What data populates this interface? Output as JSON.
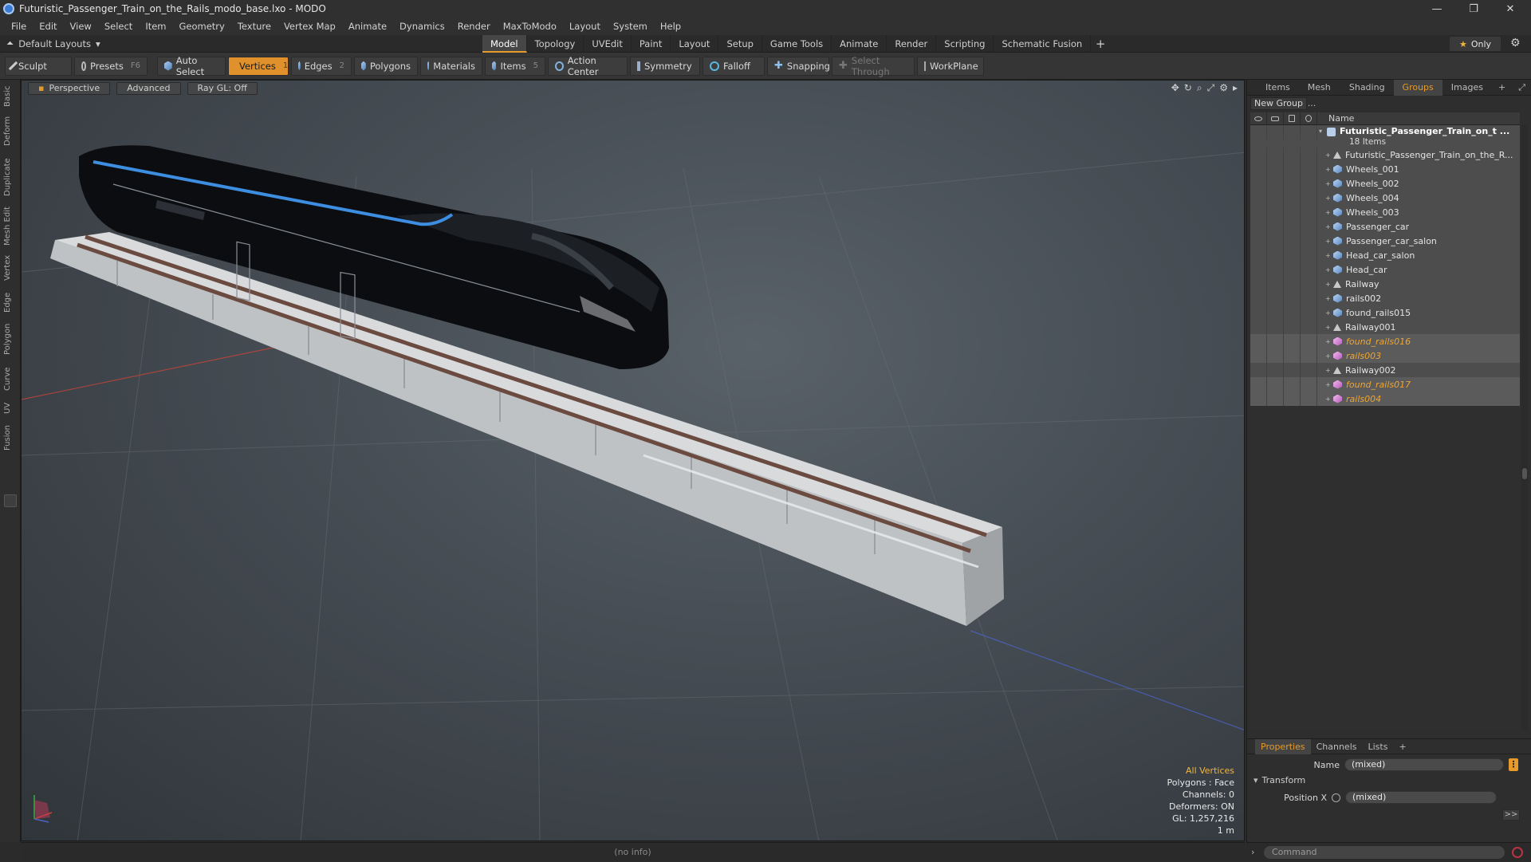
{
  "window": {
    "title": "Futuristic_Passenger_Train_on_the_Rails_modo_base.lxo - MODO",
    "controls": [
      "—",
      "❐",
      "✕"
    ]
  },
  "menu": [
    "File",
    "Edit",
    "View",
    "Select",
    "Item",
    "Geometry",
    "Texture",
    "Vertex Map",
    "Animate",
    "Dynamics",
    "Render",
    "MaxToModo",
    "Layout",
    "System",
    "Help"
  ],
  "layoutbar": {
    "layout_name": "Default Layouts",
    "tabs": [
      "Model",
      "Topology",
      "UVEdit",
      "Paint",
      "Layout",
      "Setup",
      "Game Tools",
      "Animate",
      "Render",
      "Scripting",
      "Schematic Fusion"
    ],
    "active_tab": "Model",
    "only_label": "Only"
  },
  "toolbar": {
    "sculpt": "Sculpt",
    "presets": "Presets",
    "presets_key": "F6",
    "auto_select": "Auto Select",
    "vertices": "Vertices",
    "vertices_count": "1",
    "edges": "Edges",
    "edges_count": "2",
    "polygons": "Polygons",
    "materials": "Materials",
    "items": "Items",
    "items_count": "5",
    "action_center": "Action Center",
    "symmetry": "Symmetry",
    "falloff": "Falloff",
    "snapping": "Snapping",
    "select_through": "Select Through",
    "workplane": "WorkPlane"
  },
  "left_tabs": [
    "Basic",
    "Deform",
    "Duplicate",
    "Mesh Edit",
    "Vertex",
    "Edge",
    "Polygon",
    "Curve",
    "UV",
    "Fusion"
  ],
  "viewport": {
    "view_mode": "Perspective",
    "advanced": "Advanced",
    "raygl": "Ray GL: Off",
    "info": {
      "selection": "All Vertices",
      "polygons": "Polygons : Face",
      "channels": "Channels: 0",
      "deformers": "Deformers: ON",
      "gl": "GL: 1,257,216",
      "scale": "1 m"
    }
  },
  "right_panel": {
    "tabs": [
      "Items",
      "Mesh ...",
      "Shading",
      "Groups",
      "Images"
    ],
    "active_tab": "Groups",
    "new_group": "New Group",
    "column_name": "Name",
    "group": {
      "name": "Futuristic_Passenger_Train_on_t ...",
      "count": "18 Items"
    },
    "items": [
      {
        "name": "Futuristic_Passenger_Train_on_the_R...",
        "type": "locator",
        "selected": false
      },
      {
        "name": "Wheels_001",
        "type": "mesh",
        "selected": false
      },
      {
        "name": "Wheels_002",
        "type": "mesh",
        "selected": false
      },
      {
        "name": "Wheels_004",
        "type": "mesh",
        "selected": false
      },
      {
        "name": "Wheels_003",
        "type": "mesh",
        "selected": false
      },
      {
        "name": "Passenger_car",
        "type": "mesh",
        "selected": false
      },
      {
        "name": "Passenger_car_salon",
        "type": "mesh",
        "selected": false
      },
      {
        "name": "Head_car_salon",
        "type": "mesh",
        "selected": false
      },
      {
        "name": "Head_car",
        "type": "mesh",
        "selected": false
      },
      {
        "name": "Railway",
        "type": "locator",
        "selected": false
      },
      {
        "name": "rails002",
        "type": "mesh",
        "selected": false
      },
      {
        "name": "found_rails015",
        "type": "mesh",
        "selected": false
      },
      {
        "name": "Railway001",
        "type": "locator",
        "selected": false
      },
      {
        "name": "found_rails016",
        "type": "instance",
        "selected": true
      },
      {
        "name": "rails003",
        "type": "instance",
        "selected": true
      },
      {
        "name": "Railway002",
        "type": "locator",
        "selected": false
      },
      {
        "name": "found_rails017",
        "type": "instance",
        "selected": true
      },
      {
        "name": "rails004",
        "type": "instance",
        "selected": true
      }
    ]
  },
  "properties": {
    "tabs": [
      "Properties",
      "Channels",
      "Lists"
    ],
    "active_tab": "Properties",
    "name_label": "Name",
    "name_value": "(mixed)",
    "transform_label": "Transform",
    "posx_label": "Position X",
    "posx_value": "(mixed)",
    "more_label": ">>"
  },
  "status": {
    "info": "(no info)"
  },
  "command": {
    "placeholder": "Command"
  }
}
